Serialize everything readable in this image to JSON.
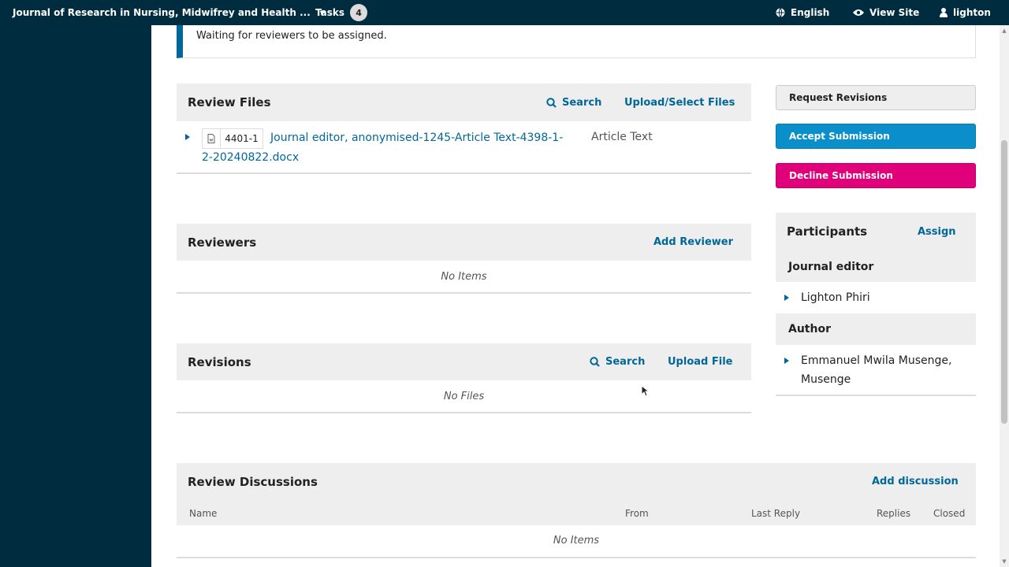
{
  "topbar": {
    "journal": "Journal of Research in Nursing, Midwifrey and Health ...",
    "tasks_label": "Tasks",
    "tasks_count": "4",
    "language": "English",
    "view_site": "View Site",
    "user": "lighton"
  },
  "notice": "Waiting for reviewers to be assigned.",
  "review_files": {
    "title": "Review Files",
    "search": "Search",
    "upload": "Upload/Select Files",
    "file": {
      "id": "4401-1",
      "name": "Journal editor, anonymised-1245-Article Text-4398-1-2-20240822.docx",
      "type": "Article Text"
    }
  },
  "reviewers": {
    "title": "Reviewers",
    "add": "Add Reviewer",
    "empty": "No Items"
  },
  "revisions": {
    "title": "Revisions",
    "search": "Search",
    "upload": "Upload File",
    "empty": "No Files"
  },
  "actions": {
    "request_revisions": "Request Revisions",
    "accept": "Accept Submission",
    "decline": "Decline Submission"
  },
  "participants": {
    "title": "Participants",
    "assign": "Assign",
    "groups": [
      {
        "role": "Journal editor",
        "people": [
          "Lighton Phiri"
        ]
      },
      {
        "role": "Author",
        "people": [
          "Emmanuel Mwila Musenge, Musenge"
        ]
      }
    ]
  },
  "discussions": {
    "title": "Review Discussions",
    "add": "Add discussion",
    "columns": [
      "Name",
      "From",
      "Last Reply",
      "Replies",
      "Closed"
    ],
    "empty": "No Items"
  },
  "colors": {
    "nav": "#002c40",
    "link": "#006798",
    "accept": "#0b8fcb",
    "decline": "#e0007a"
  }
}
